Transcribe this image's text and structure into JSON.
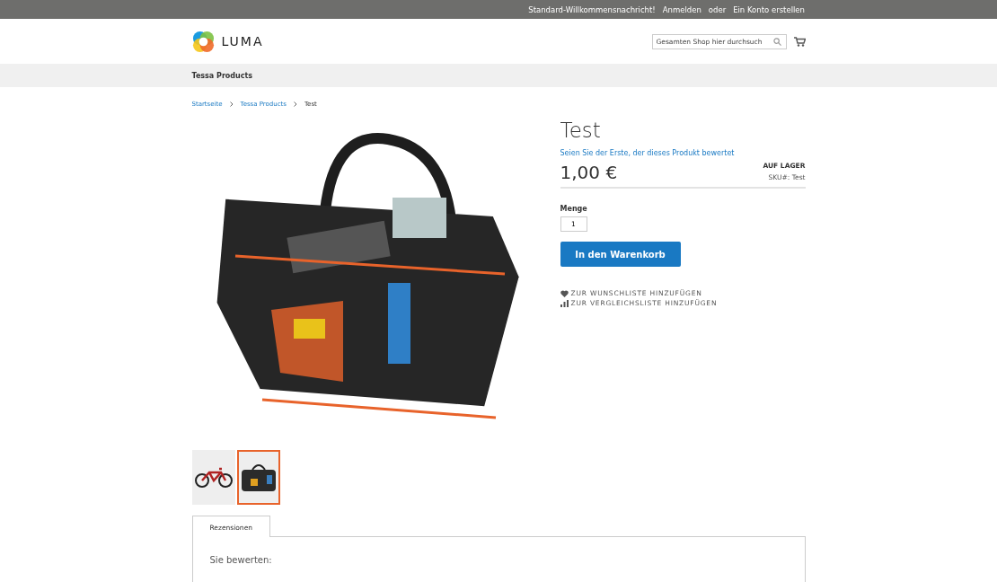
{
  "top_bar": {
    "welcome": "Standard-Willkommensnachricht!",
    "login": "Anmelden",
    "separator": "oder",
    "register": "Ein Konto erstellen"
  },
  "header": {
    "logo_text": "LUMA",
    "search": {
      "placeholder": "Gesamten Shop hier durchsuch"
    }
  },
  "nav": {
    "items": [
      {
        "label": "Tessa Products"
      }
    ]
  },
  "breadcrumbs": [
    {
      "label": "Startseite",
      "kind": "link"
    },
    {
      "label": "Tessa Products",
      "kind": "link"
    },
    {
      "label": "Test",
      "kind": "current"
    }
  ],
  "gallery": {
    "thumbnails": [
      {
        "kind": "bike",
        "selected": false
      },
      {
        "kind": "bag",
        "selected": true
      }
    ]
  },
  "product": {
    "title": "Test",
    "review_link": "Seien Sie der Erste, der dieses Produkt bewertet",
    "price": "1,00 €",
    "stock": "AUF LAGER",
    "sku_label": "SKU#:",
    "sku_value": "Test",
    "qty_label": "Menge",
    "qty_value": "1",
    "add_button": "In den Warenkorb",
    "actions": [
      {
        "kind": "wishlist",
        "label": "ZUR WUNSCHLISTE HINZUFÜGEN"
      },
      {
        "kind": "compare",
        "label": "ZUR VERGLEICHSLISTE HINZUFÜGEN"
      }
    ]
  },
  "tabs": [
    {
      "label": "Rezensionen",
      "selected": true
    }
  ],
  "tab_content": {
    "text": "Sie bewerten:"
  }
}
